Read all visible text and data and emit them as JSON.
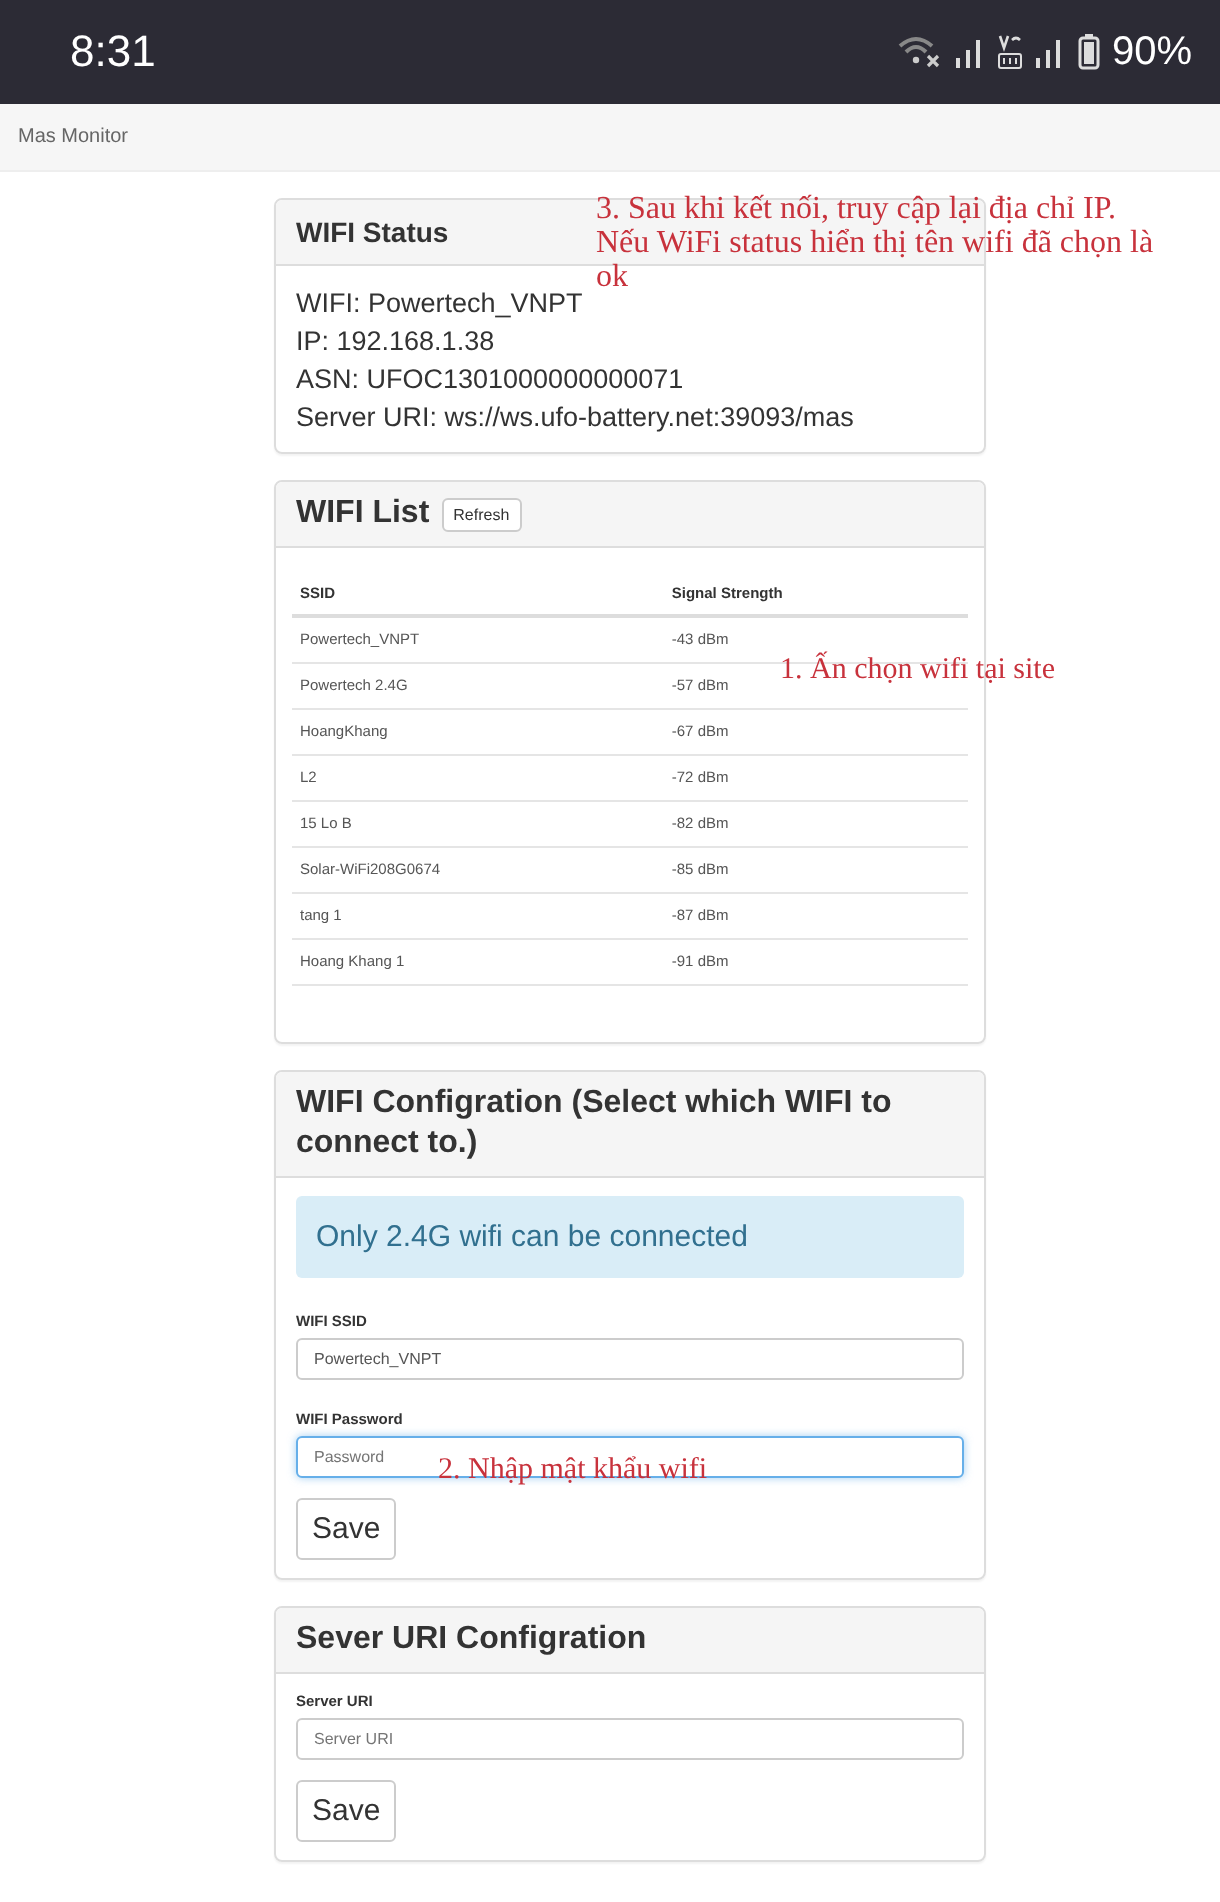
{
  "status_bar": {
    "time": "8:31",
    "battery": "90%"
  },
  "app_bar": {
    "title": "Mas Monitor"
  },
  "wifi_status": {
    "title": "WIFI Status",
    "lines": [
      "WIFI: Powertech_VNPT",
      "IP: 192.168.1.38",
      "ASN: UFOC1301000000000071",
      "Server URI: ws://ws.ufo-battery.net:39093/mas"
    ]
  },
  "wifi_list": {
    "title": "WIFI List",
    "refresh_button": "Refresh",
    "columns": [
      "SSID",
      "Signal Strength"
    ],
    "rows": [
      {
        "ssid": "Powertech_VNPT",
        "signal": "-43 dBm"
      },
      {
        "ssid": "Powertech 2.4G",
        "signal": "-57 dBm"
      },
      {
        "ssid": "HoangKhang",
        "signal": "-67 dBm"
      },
      {
        "ssid": "L2",
        "signal": "-72 dBm"
      },
      {
        "ssid": "15 Lo B",
        "signal": "-82 dBm"
      },
      {
        "ssid": "Solar-WiFi208G0674",
        "signal": "-85 dBm"
      },
      {
        "ssid": "tang 1",
        "signal": "-87 dBm"
      },
      {
        "ssid": "Hoang Khang 1",
        "signal": "-91 dBm"
      }
    ]
  },
  "wifi_config": {
    "title": "WIFI Configration (Select which WIFI to connect to.)",
    "alert": "Only 2.4G wifi can be connected",
    "fields": [
      {
        "label": "WIFI SSID",
        "value": "Powertech_VNPT",
        "focused": false
      },
      {
        "label": "WIFI Password",
        "placeholder": "Password",
        "focused": true
      }
    ],
    "save_button": "Save"
  },
  "server_config": {
    "title": "Sever URI Configration",
    "fields": [
      {
        "label": "Server URI",
        "placeholder": "Server URI",
        "focused": false
      }
    ],
    "save_button": "Save"
  },
  "annotations": [
    {
      "text": "3. Sau khi kết nối, truy cập lại địa chỉ IP. Nếu WiFi status hiển thị tên wifi đã chọn là ok"
    },
    {
      "text": "1. Ấn chọn wifi tại site"
    },
    {
      "text": "2. Nhập mật khẩu wifi"
    }
  ]
}
